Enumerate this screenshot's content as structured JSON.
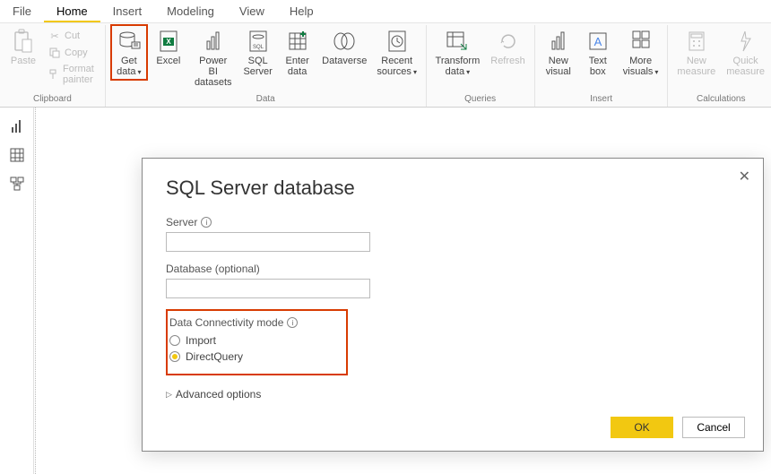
{
  "menubar": [
    "File",
    "Home",
    "Insert",
    "Modeling",
    "View",
    "Help"
  ],
  "active_menu": "Home",
  "ribbon": {
    "clipboard": {
      "label": "Clipboard",
      "paste": "Paste",
      "cut": "Cut",
      "copy": "Copy",
      "format_painter": "Format painter"
    },
    "data": {
      "label": "Data",
      "get_data": "Get\ndata",
      "excel": "Excel",
      "pbi_datasets": "Power BI\ndatasets",
      "sql_server": "SQL\nServer",
      "enter_data": "Enter\ndata",
      "dataverse": "Dataverse",
      "recent_sources": "Recent\nsources"
    },
    "queries": {
      "label": "Queries",
      "transform": "Transform\ndata",
      "refresh": "Refresh"
    },
    "insert": {
      "label": "Insert",
      "new_visual": "New\nvisual",
      "text_box": "Text\nbox",
      "more_visuals": "More\nvisuals"
    },
    "calc": {
      "label": "Calculations",
      "new_measure": "New\nmeasure",
      "quick_measure": "Quick\nmeasure"
    }
  },
  "dialog": {
    "title": "SQL Server database",
    "server_label": "Server",
    "server_value": "",
    "database_label": "Database (optional)",
    "database_value": "",
    "conn_mode_label": "Data Connectivity mode",
    "radio_import": "Import",
    "radio_directquery": "DirectQuery",
    "selected_mode": "DirectQuery",
    "advanced": "Advanced options",
    "ok": "OK",
    "cancel": "Cancel"
  }
}
